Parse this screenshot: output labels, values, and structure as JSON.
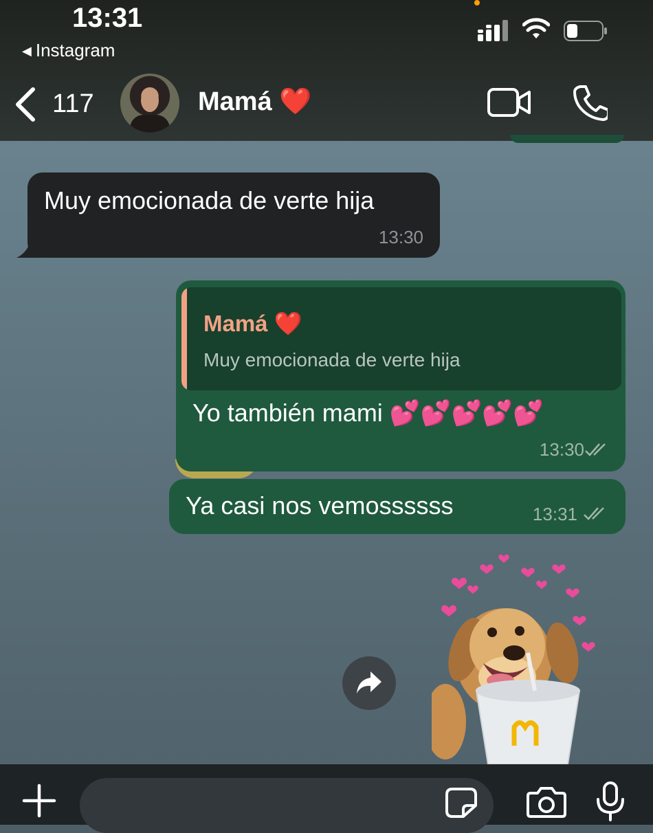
{
  "status_bar": {
    "time": "13:31",
    "back_app": "Instagram",
    "icons": [
      "signal-icon",
      "wifi-icon",
      "battery-icon"
    ]
  },
  "header": {
    "back_count": "117",
    "contact_name": "Mamá ❤️",
    "actions": [
      "video-call-icon",
      "phone-call-icon"
    ]
  },
  "messages": [
    {
      "direction": "incoming",
      "text": "Muy emocionada de verte hija",
      "time": "13:30"
    },
    {
      "direction": "outgoing",
      "reply_to": {
        "name": "Mamá ❤️",
        "text": "Muy emocionada de verte hija"
      },
      "text": "Yo también mami 💕💕💕💕💕",
      "time": "13:30",
      "status": "read-double-check"
    },
    {
      "direction": "outgoing",
      "text": "Ya casi nos vemossssss",
      "time": "13:31",
      "status": "read-double-check"
    },
    {
      "direction": "outgoing",
      "type": "sticker",
      "sticker": "puppy-with-mcdonalds-cup-and-hearts"
    }
  ],
  "composer": {
    "placeholder": "",
    "icons": [
      "plus-icon",
      "sticker-icon",
      "camera-icon",
      "microphone-icon"
    ]
  },
  "colors": {
    "outgoing_bubble": "#1f5a3e",
    "incoming_bubble": "#202223",
    "quote_accent": "#f1a285"
  }
}
